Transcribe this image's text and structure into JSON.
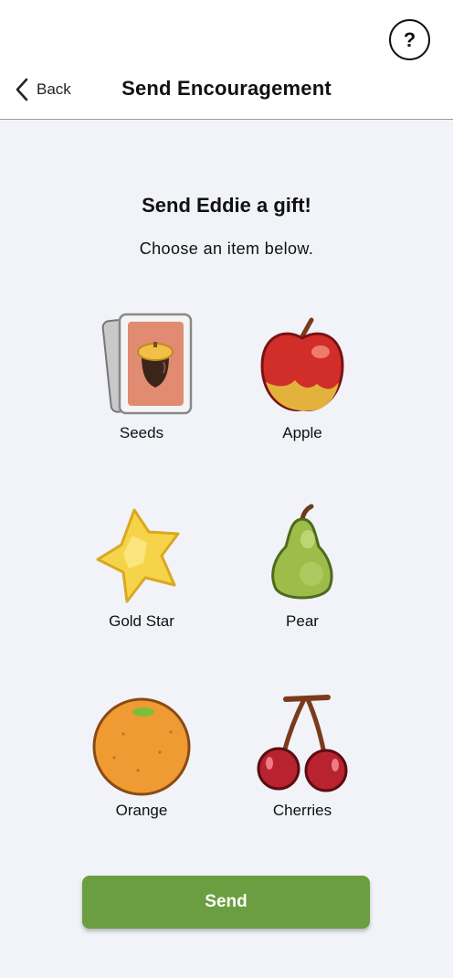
{
  "header": {
    "title": "Send Encouragement",
    "back_label": "Back",
    "help_label": "?"
  },
  "main": {
    "heading": "Send Eddie a gift!",
    "subheading": "Choose an item below.",
    "gifts": [
      {
        "label": "Seeds",
        "icon": "seed-card-icon"
      },
      {
        "label": "Apple",
        "icon": "apple-icon"
      },
      {
        "label": "Gold Star",
        "icon": "gold-star-icon"
      },
      {
        "label": "Pear",
        "icon": "pear-icon"
      },
      {
        "label": "Orange",
        "icon": "orange-icon"
      },
      {
        "label": "Cherries",
        "icon": "cherries-icon"
      }
    ],
    "send_label": "Send"
  },
  "colors": {
    "background": "#f1f3f8",
    "send_button": "#6a9e40"
  }
}
